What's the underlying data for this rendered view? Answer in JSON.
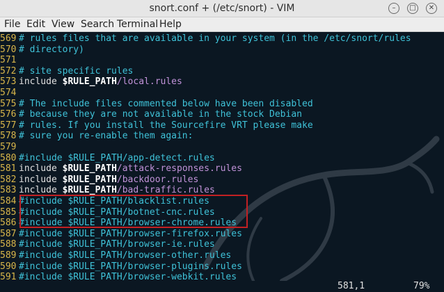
{
  "window": {
    "title": "snort.conf + (/etc/snort) - VIM",
    "buttons": {
      "minimize": "–",
      "maximize": "□",
      "close": "✕"
    }
  },
  "menu": [
    "File",
    "Edit",
    "View",
    "Search",
    "Terminal",
    "Help"
  ],
  "editor": {
    "lines": [
      {
        "num": "569",
        "parts": [
          {
            "c": "comment",
            "t": "# rules files that are available in your system (in the /etc/snort/rules"
          }
        ]
      },
      {
        "num": "570",
        "parts": [
          {
            "c": "comment",
            "t": "# directory)"
          }
        ]
      },
      {
        "num": "571",
        "parts": []
      },
      {
        "num": "572",
        "parts": [
          {
            "c": "comment",
            "t": "# site specific rules"
          }
        ]
      },
      {
        "num": "573",
        "parts": [
          {
            "c": "kw",
            "t": "include "
          },
          {
            "c": "var",
            "t": "$RULE_PATH"
          },
          {
            "c": "path",
            "t": "/local.rules"
          }
        ]
      },
      {
        "num": "574",
        "parts": []
      },
      {
        "num": "575",
        "parts": [
          {
            "c": "comment",
            "t": "# The include files commented below have been disabled"
          }
        ]
      },
      {
        "num": "576",
        "parts": [
          {
            "c": "comment",
            "t": "# because they are not available in the stock Debian"
          }
        ]
      },
      {
        "num": "577",
        "parts": [
          {
            "c": "comment",
            "t": "# rules. If you install the Sourcefire VRT please make"
          }
        ]
      },
      {
        "num": "578",
        "parts": [
          {
            "c": "comment",
            "t": "# sure you re-enable them again:"
          }
        ]
      },
      {
        "num": "579",
        "parts": []
      },
      {
        "num": "580",
        "parts": [
          {
            "c": "plain",
            "t": "#include $RULE_PATH/app-detect.rules"
          }
        ]
      },
      {
        "num": "581",
        "parts": [
          {
            "c": "kw",
            "t": "include "
          },
          {
            "c": "var",
            "t": "$RULE_PATH"
          },
          {
            "c": "path",
            "t": "/attack-responses.rules"
          }
        ]
      },
      {
        "num": "582",
        "parts": [
          {
            "c": "kw",
            "t": "include "
          },
          {
            "c": "var",
            "t": "$RULE_PATH"
          },
          {
            "c": "path",
            "t": "/backdoor.rules"
          }
        ]
      },
      {
        "num": "583",
        "parts": [
          {
            "c": "kw",
            "t": "include "
          },
          {
            "c": "var",
            "t": "$RULE_PATH"
          },
          {
            "c": "path",
            "t": "/bad-traffic.rules"
          }
        ]
      },
      {
        "num": "584",
        "parts": [
          {
            "c": "plain",
            "t": "#include $RULE_PATH/blacklist.rules"
          }
        ]
      },
      {
        "num": "585",
        "parts": [
          {
            "c": "plain",
            "t": "#include $RULE_PATH/botnet-cnc.rules"
          }
        ]
      },
      {
        "num": "586",
        "parts": [
          {
            "c": "plain",
            "t": "#include $RULE_PATH/browser-chrome.rules"
          }
        ]
      },
      {
        "num": "587",
        "parts": [
          {
            "c": "plain",
            "t": "#include $RULE_PATH/browser-firefox.rules"
          }
        ]
      },
      {
        "num": "588",
        "parts": [
          {
            "c": "plain",
            "t": "#include $RULE_PATH/browser-ie.rules"
          }
        ]
      },
      {
        "num": "589",
        "parts": [
          {
            "c": "plain",
            "t": "#include $RULE_PATH/browser-other.rules"
          }
        ]
      },
      {
        "num": "590",
        "parts": [
          {
            "c": "plain",
            "t": "#include $RULE_PATH/browser-plugins.rules"
          }
        ]
      },
      {
        "num": "591",
        "parts": [
          {
            "c": "plain",
            "t": "#include $RULE_PATH/browser-webkit.rules"
          }
        ]
      }
    ]
  },
  "status": {
    "position": "581,1",
    "percent": "79%"
  }
}
